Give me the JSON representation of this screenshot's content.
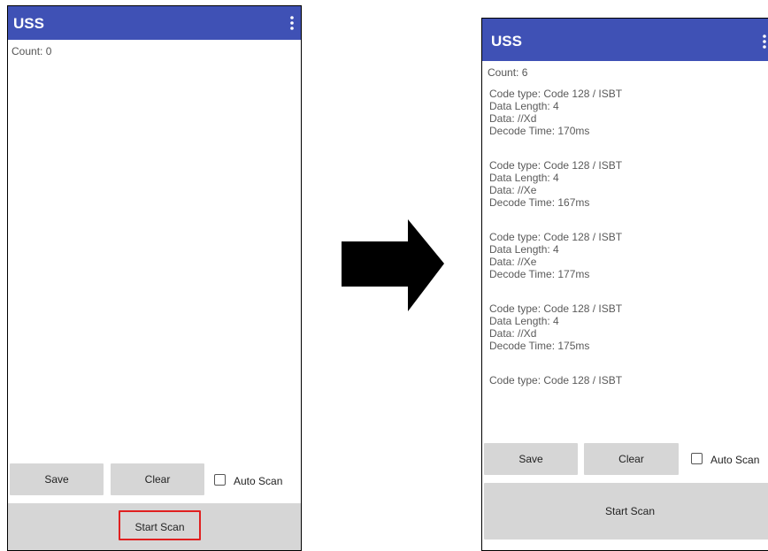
{
  "left_screen": {
    "app_title": "USS",
    "count_label": "Count:  0",
    "save_label": "Save",
    "clear_label": "Clear",
    "auto_scan_label": "Auto Scan",
    "start_scan_label": "Start Scan"
  },
  "right_screen": {
    "app_title": "USS",
    "count_label": "Count:  6",
    "results": [
      {
        "code_type": "Code type: Code 128 / ISBT",
        "data_length": "Data Length: 4",
        "data": "Data: //Xd",
        "decode_time": "Decode Time: 170ms"
      },
      {
        "code_type": "Code type: Code 128 / ISBT",
        "data_length": "Data Length: 4",
        "data": "Data: //Xe",
        "decode_time": "Decode Time: 167ms"
      },
      {
        "code_type": "Code type: Code 128 / ISBT",
        "data_length": "Data Length: 4",
        "data": "Data: //Xe",
        "decode_time": "Decode Time: 177ms"
      },
      {
        "code_type": "Code type: Code 128 / ISBT",
        "data_length": "Data Length: 4",
        "data": "Data: //Xd",
        "decode_time": "Decode Time: 175ms"
      },
      {
        "code_type": "Code type: Code 128 / ISBT"
      }
    ],
    "save_label": "Save",
    "clear_label": "Clear",
    "auto_scan_label": "Auto Scan",
    "start_scan_label": "Start Scan"
  },
  "colors": {
    "appbar": "#3f51b5",
    "highlight": "#e02020",
    "button_bg": "#d6d6d6"
  },
  "icons": [
    "more-vert-icon",
    "right-arrow-icon"
  ]
}
